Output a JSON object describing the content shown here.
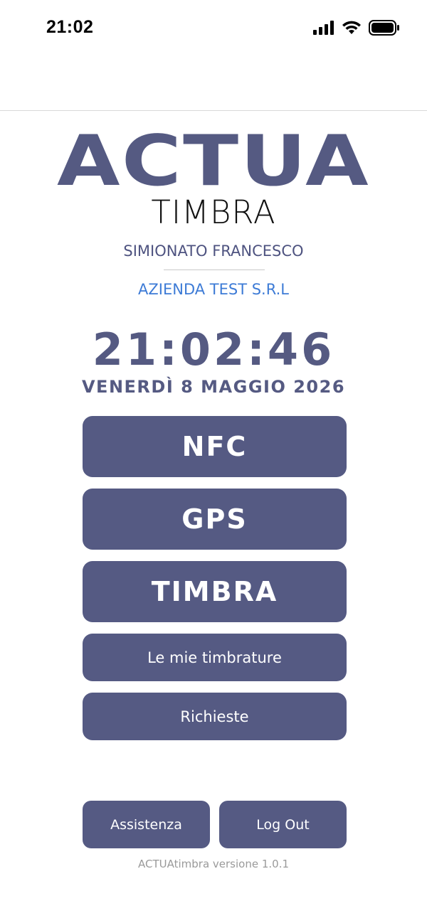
{
  "status_bar": {
    "time": "21:02",
    "icons": [
      "signal-icon",
      "wifi-icon",
      "battery-icon"
    ]
  },
  "logo": {
    "brand": "ACTUA",
    "product": "TIMBRA",
    "color": "#555a82"
  },
  "user": {
    "name": "SIMIONATO FRANCESCO",
    "company": "AZIENDA TEST S.R.L"
  },
  "clock": {
    "time": "21:02:46",
    "date": "VENERDÌ 8 MAGGIO 2026"
  },
  "actions": {
    "nfc": "NFC",
    "gps": "GPS",
    "timbra": "TIMBRA",
    "mie_timbrature": "Le mie timbrature",
    "richieste": "Richieste"
  },
  "footer": {
    "assistenza": "Assistenza",
    "logout": "Log Out",
    "version": "ACTUAtimbra versione 1.0.1"
  },
  "colors": {
    "primary": "#555a83",
    "company": "#3d7bd6",
    "muted": "#9a9a9a"
  }
}
